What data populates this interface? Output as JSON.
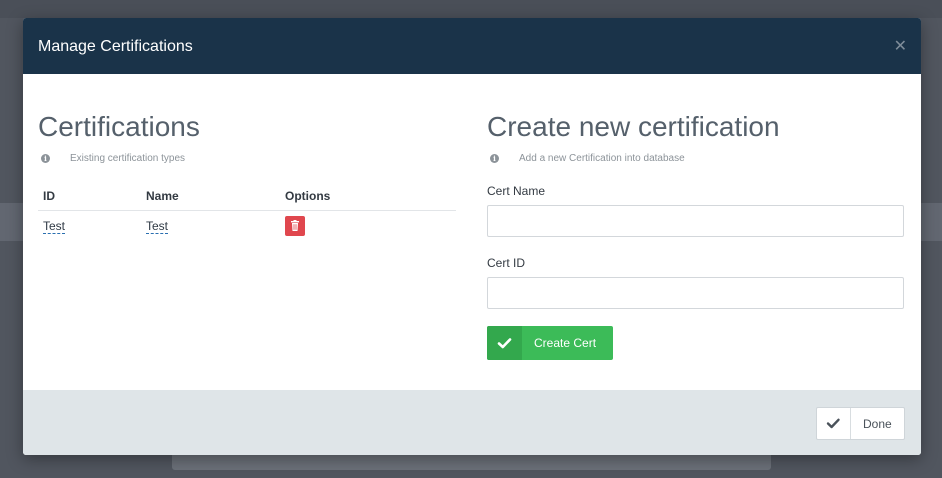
{
  "modal": {
    "title": "Manage Certifications",
    "close_icon": "close-icon"
  },
  "certifications": {
    "title": "Certifications",
    "subtitle": "Existing certification types",
    "info_icon": "info-icon",
    "columns": [
      "ID",
      "Name",
      "Options"
    ],
    "rows": [
      {
        "id": "Test",
        "name": "Test",
        "option_icon": "trash-icon"
      }
    ]
  },
  "create": {
    "title": "Create new certification",
    "subtitle": "Add a new Certification into database",
    "info_icon": "info-icon",
    "cert_name_label": "Cert Name",
    "cert_name_value": "",
    "cert_id_label": "Cert ID",
    "cert_id_value": "",
    "button_label": "Create Cert",
    "button_icon": "check-icon"
  },
  "footer": {
    "done_label": "Done",
    "done_icon": "check-icon"
  },
  "colors": {
    "header_bg": "#1a3349",
    "success": "#3cbb58",
    "danger": "#e0474e",
    "footer_bg": "#dfe5e8"
  }
}
